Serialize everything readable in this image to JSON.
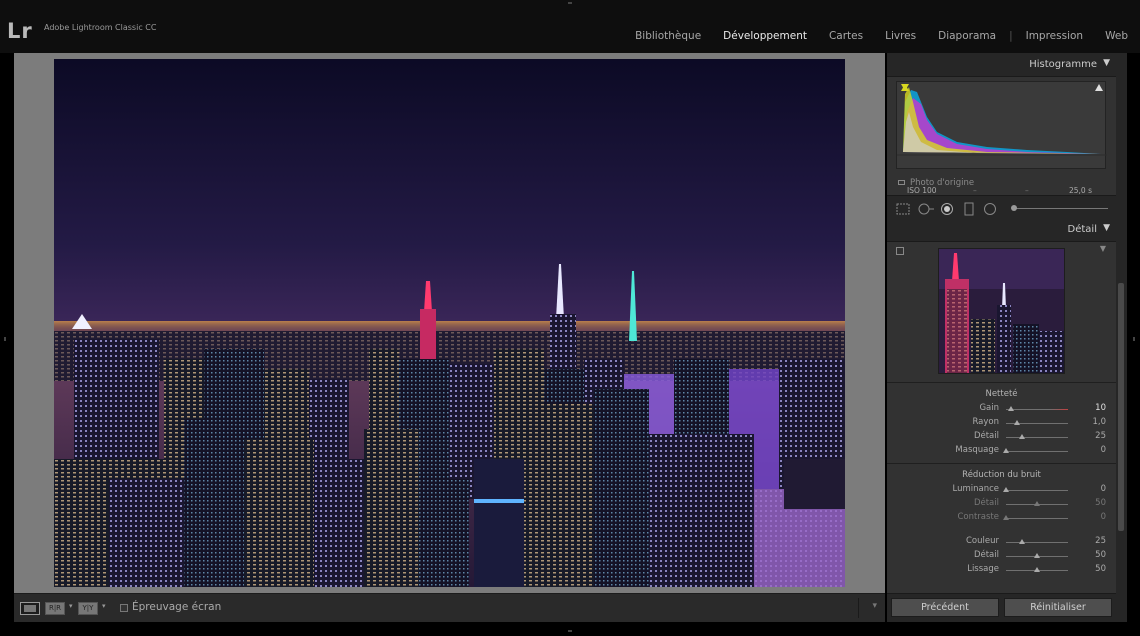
{
  "app": {
    "logo": "Lr",
    "name": "Adobe Lightroom Classic CC"
  },
  "modules": [
    {
      "label": "Bibliothèque",
      "active": false
    },
    {
      "label": "Développement",
      "active": true
    },
    {
      "label": "Cartes",
      "active": false
    },
    {
      "label": "Livres",
      "active": false
    },
    {
      "label": "Diaporama",
      "active": false
    },
    {
      "label": "Impression",
      "active": false
    },
    {
      "label": "Web",
      "active": false
    }
  ],
  "toolbar": {
    "proof_label": "Épreuvage écran",
    "view_btn1": "R|R",
    "view_btn2": "Y|Y"
  },
  "histogram": {
    "title": "Histogramme",
    "iso": "ISO 100",
    "dash1": "–",
    "dash2": "–",
    "shutter": "25,0 s",
    "original_label": "Photo d'origine"
  },
  "detail": {
    "title": "Détail",
    "sharpening": {
      "title": "Netteté",
      "sliders": [
        {
          "label": "Gain",
          "value": "10",
          "fraction": 0.07
        },
        {
          "label": "Rayon",
          "value": "1,0",
          "fraction": 0.17
        },
        {
          "label": "Détail",
          "value": "25",
          "fraction": 0.25
        },
        {
          "label": "Masquage",
          "value": "0",
          "fraction": 0.0
        }
      ]
    },
    "noise": {
      "title": "Réduction du bruit",
      "sliders": [
        {
          "label": "Luminance",
          "value": "0",
          "fraction": 0.0
        },
        {
          "label": "Détail",
          "value": "50",
          "fraction": 0.5
        },
        {
          "label": "Contraste",
          "value": "0",
          "fraction": 0.0
        },
        {
          "label": "Couleur",
          "value": "25",
          "fraction": 0.25
        },
        {
          "label": "Détail",
          "value": "50",
          "fraction": 0.5
        },
        {
          "label": "Lissage",
          "value": "50",
          "fraction": 0.5
        }
      ]
    }
  },
  "buttons": {
    "previous": "Précédent",
    "reset": "Réinitialiser"
  }
}
